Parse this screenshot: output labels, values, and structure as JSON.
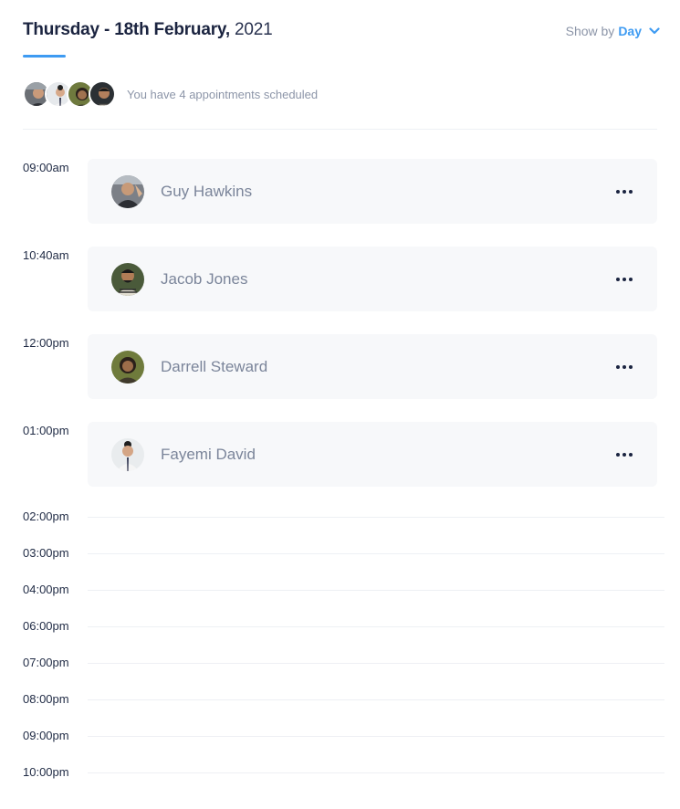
{
  "header": {
    "title_bold": "Thursday - 18th February,",
    "title_year": "2021",
    "showby_label": "Show by",
    "showby_value": "Day",
    "accent": "#3e9bf2"
  },
  "summary": {
    "text": "You have 4 appointments scheduled"
  },
  "appointments": [
    {
      "time": "09:00am",
      "name": "Guy Hawkins"
    },
    {
      "time": "10:40am",
      "name": "Jacob Jones"
    },
    {
      "time": "12:00pm",
      "name": "Darrell Steward"
    },
    {
      "time": "01:00pm",
      "name": "Fayemi David"
    }
  ],
  "empty_slots": [
    "02:00pm",
    "03:00pm",
    "04:00pm",
    "06:00pm",
    "07:00pm",
    "08:00pm",
    "09:00pm",
    "10:00pm"
  ],
  "icons": {
    "chevron": "chevron-down-icon",
    "more": "more-horizontal-icon"
  }
}
